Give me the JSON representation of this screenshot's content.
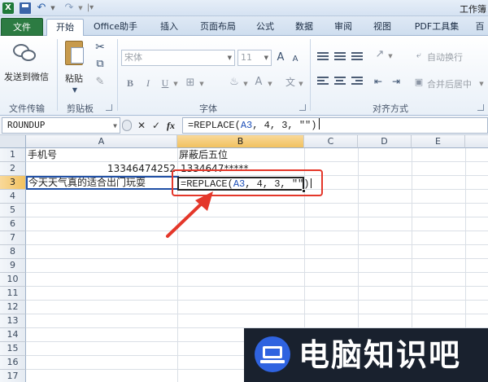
{
  "titlebar": {
    "window_title": "工作簿",
    "app_icon": "excel-icon",
    "quick_access": [
      "save-icon",
      "undo-icon",
      "redo-icon"
    ]
  },
  "ribbon": {
    "tabs": [
      "文件",
      "开始",
      "Office助手",
      "插入",
      "页面布局",
      "公式",
      "数据",
      "审阅",
      "视图",
      "PDF工具集",
      "百"
    ],
    "active_tab": "开始",
    "groups": {
      "transfer": {
        "label": "文件传输",
        "button": "发送到微信"
      },
      "clipboard": {
        "label": "剪贴板",
        "paste": "粘贴"
      },
      "font": {
        "label": "字体",
        "font_name": "宋体",
        "font_size": "11",
        "bold": "B",
        "italic": "I",
        "underline": "U",
        "grow": "A",
        "shrink": "A"
      },
      "alignment": {
        "label": "对齐方式",
        "wrap": "自动换行",
        "merge": "合并后居中"
      }
    }
  },
  "formula_bar": {
    "name_box": "ROUNDUP",
    "cancel": "✕",
    "confirm": "✓",
    "fx": "fx",
    "formula_prefix": "=REPLACE(",
    "formula_ref": "A3",
    "formula_suffix": ", 4, 3, \"\")"
  },
  "sheet": {
    "columns": [
      "A",
      "B",
      "C",
      "D",
      "E"
    ],
    "selected_column": "B",
    "rows": [
      "1",
      "2",
      "3",
      "4",
      "5",
      "6",
      "7",
      "8",
      "9",
      "10",
      "11",
      "12",
      "13",
      "14",
      "15",
      "16",
      "17"
    ],
    "selected_row": "3",
    "cells": {
      "A1": "手机号",
      "B1": "屏蔽后五位",
      "A2": "13346474252",
      "B2": "1334647*****",
      "A3": "今天天气真的适合出门玩耍"
    },
    "editing": {
      "cell": "B3",
      "prefix": "=REPLACE(",
      "ref": "A3",
      "suffix": ", 4, 3, \"\")"
    }
  },
  "annotation": {
    "box_color": "#e4372a",
    "arrow_color": "#e4372a"
  },
  "watermark": {
    "text": "电脑知识吧",
    "icon": "monitor-icon",
    "icon_color": "#2f63e0"
  }
}
